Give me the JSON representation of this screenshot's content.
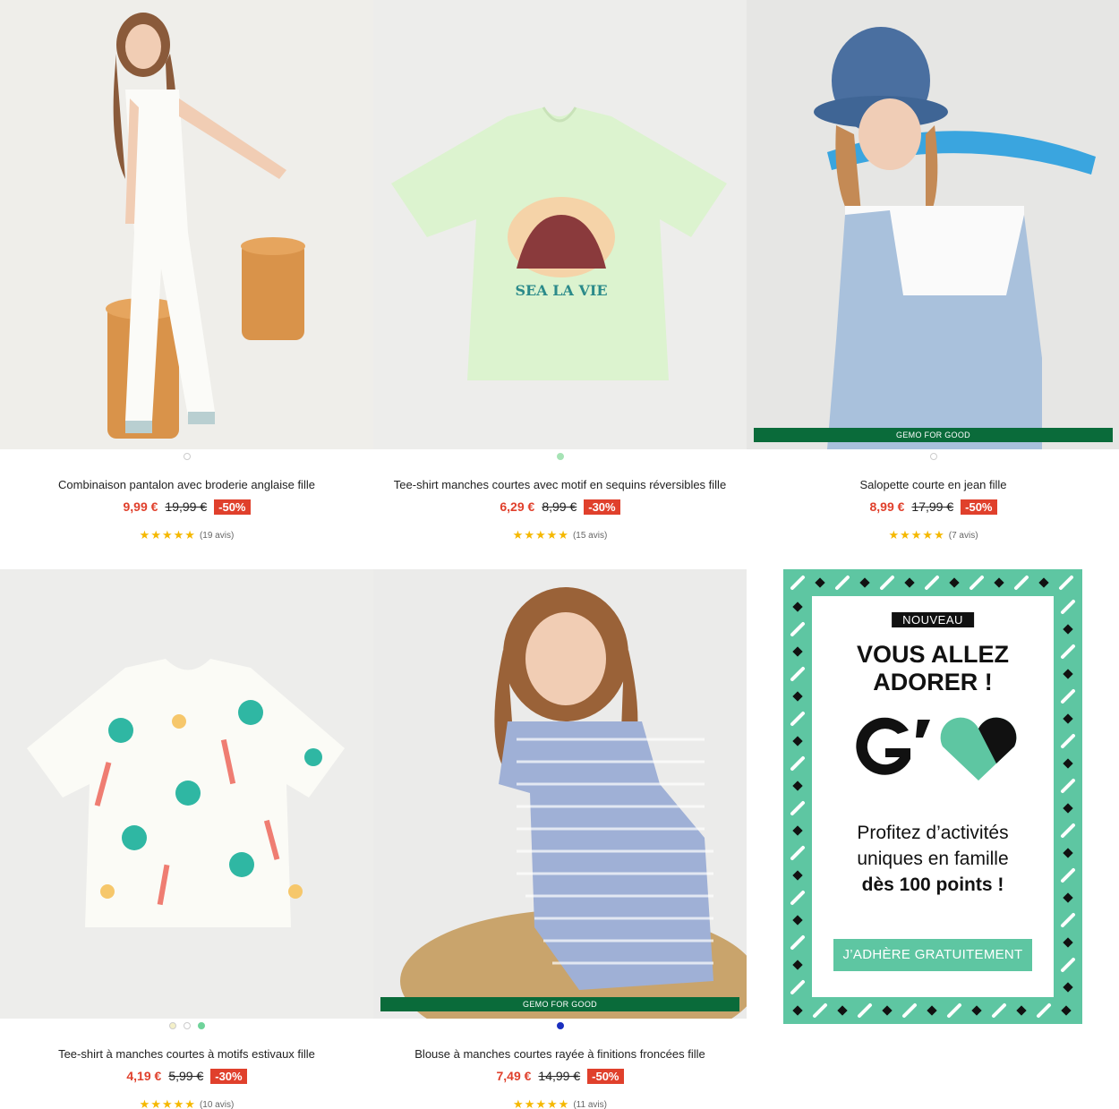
{
  "products": [
    {
      "name": "Combinaison pantalon avec broderie anglaise fille",
      "price": "9,99 €",
      "old_price": "19,99 €",
      "discount": "-50%",
      "stars": "★★★★★",
      "reviews": "(19 avis)",
      "badge": "",
      "dots": [
        "#ffffff"
      ]
    },
    {
      "name": "Tee-shirt manches courtes avec motif en sequins réversibles fille",
      "price": "6,29 €",
      "old_price": "8,99 €",
      "discount": "-30%",
      "stars": "★★★★★",
      "reviews": "(15 avis)",
      "badge": "",
      "dots": [
        "#a6e3b5"
      ]
    },
    {
      "name": "Salopette courte en jean fille",
      "price": "8,99 €",
      "old_price": "17,99 €",
      "discount": "-50%",
      "stars": "★★★★★",
      "reviews": "(7 avis)",
      "badge": "GEMO FOR GOOD",
      "dots": [
        "#ffffff"
      ]
    },
    {
      "name": "Tee-shirt à manches courtes à motifs estivaux fille",
      "price": "4,19 €",
      "old_price": "5,99 €",
      "discount": "-30%",
      "stars": "★★★★★",
      "reviews": "(10 avis)",
      "badge": "",
      "dots": [
        "#f4f0c8",
        "#ffffff",
        "#6fd39a"
      ]
    },
    {
      "name": "Blouse à manches courtes rayée à finitions froncées fille",
      "price": "7,49 €",
      "old_price": "14,99 €",
      "discount": "-50%",
      "stars": "★★★★★",
      "reviews": "(11 avis)",
      "badge": "GEMO FOR GOOD",
      "dots": [
        "#1b2fbf"
      ]
    }
  ],
  "promo": {
    "tag": "NOUVEAU",
    "title_line1": "VOUS ALLEZ",
    "title_line2": "ADORER !",
    "text_line1": "Profitez d’activités",
    "text_line2": "uniques en famille",
    "text_line3": "dès 100 points !",
    "button": "J’ADHÈRE GRATUITEMENT",
    "accent_color": "#5ec6a2"
  }
}
